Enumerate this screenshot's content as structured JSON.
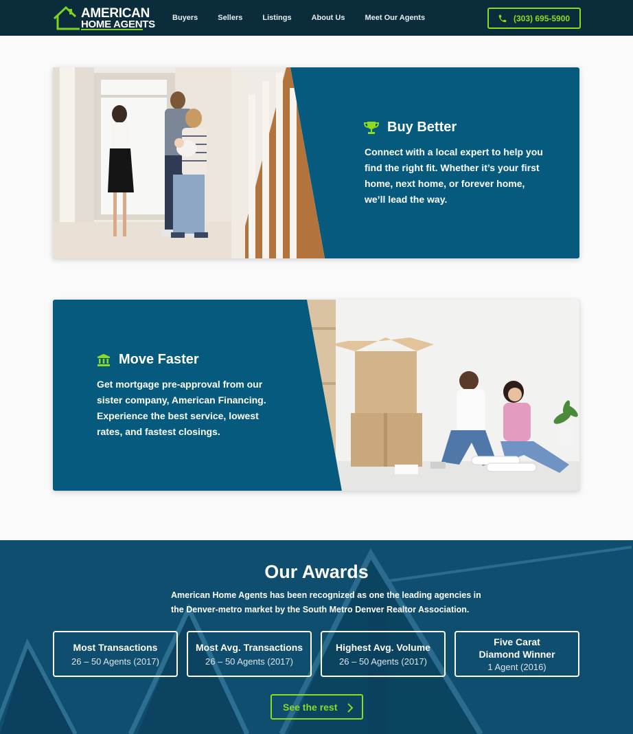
{
  "header": {
    "logo_line1": "AMERICAN",
    "logo_line2": "HOME AGENTS",
    "nav": [
      "Buyers",
      "Sellers",
      "Listings",
      "About Us",
      "Meet Our Agents"
    ],
    "phone": "(303) 695-5900"
  },
  "features": [
    {
      "title": "Buy Better",
      "icon": "trophy-icon",
      "text": "Connect with a local expert to help you find the right fit. Whether it’s your first home, next home, or forever home, we’ll lead the way."
    },
    {
      "title": "Move Faster",
      "icon": "bank-icon",
      "text": "Get mortgage pre-approval from our sister company, American Financing. Experience the best service, lowest rates, and fastest closings."
    }
  ],
  "awards": {
    "title": "Our Awards",
    "subtitle_line1": "American Home Agents has been recognized as one the leading agencies in",
    "subtitle_line2": "the Denver-metro market by the South Metro Denver Realtor Association.",
    "items": [
      {
        "name": "Most Transactions",
        "desc": "26 – 50 Agents (2017)"
      },
      {
        "name": "Most Avg. Transactions",
        "desc": "26 – 50 Agents (2017)"
      },
      {
        "name": "Highest Avg. Volume",
        "desc": "26 – 50 Agents (2017)"
      },
      {
        "name_line1": "Five Carat",
        "name_line2": "Diamond Winner",
        "desc": "1 Agent (2016)"
      }
    ],
    "cta": "See the rest"
  },
  "colors": {
    "header_bg": "#0b2c3b",
    "card_bg": "#065a7e",
    "accent_green": "#8ddc1f",
    "awards_bg": "#0e4a68"
  }
}
